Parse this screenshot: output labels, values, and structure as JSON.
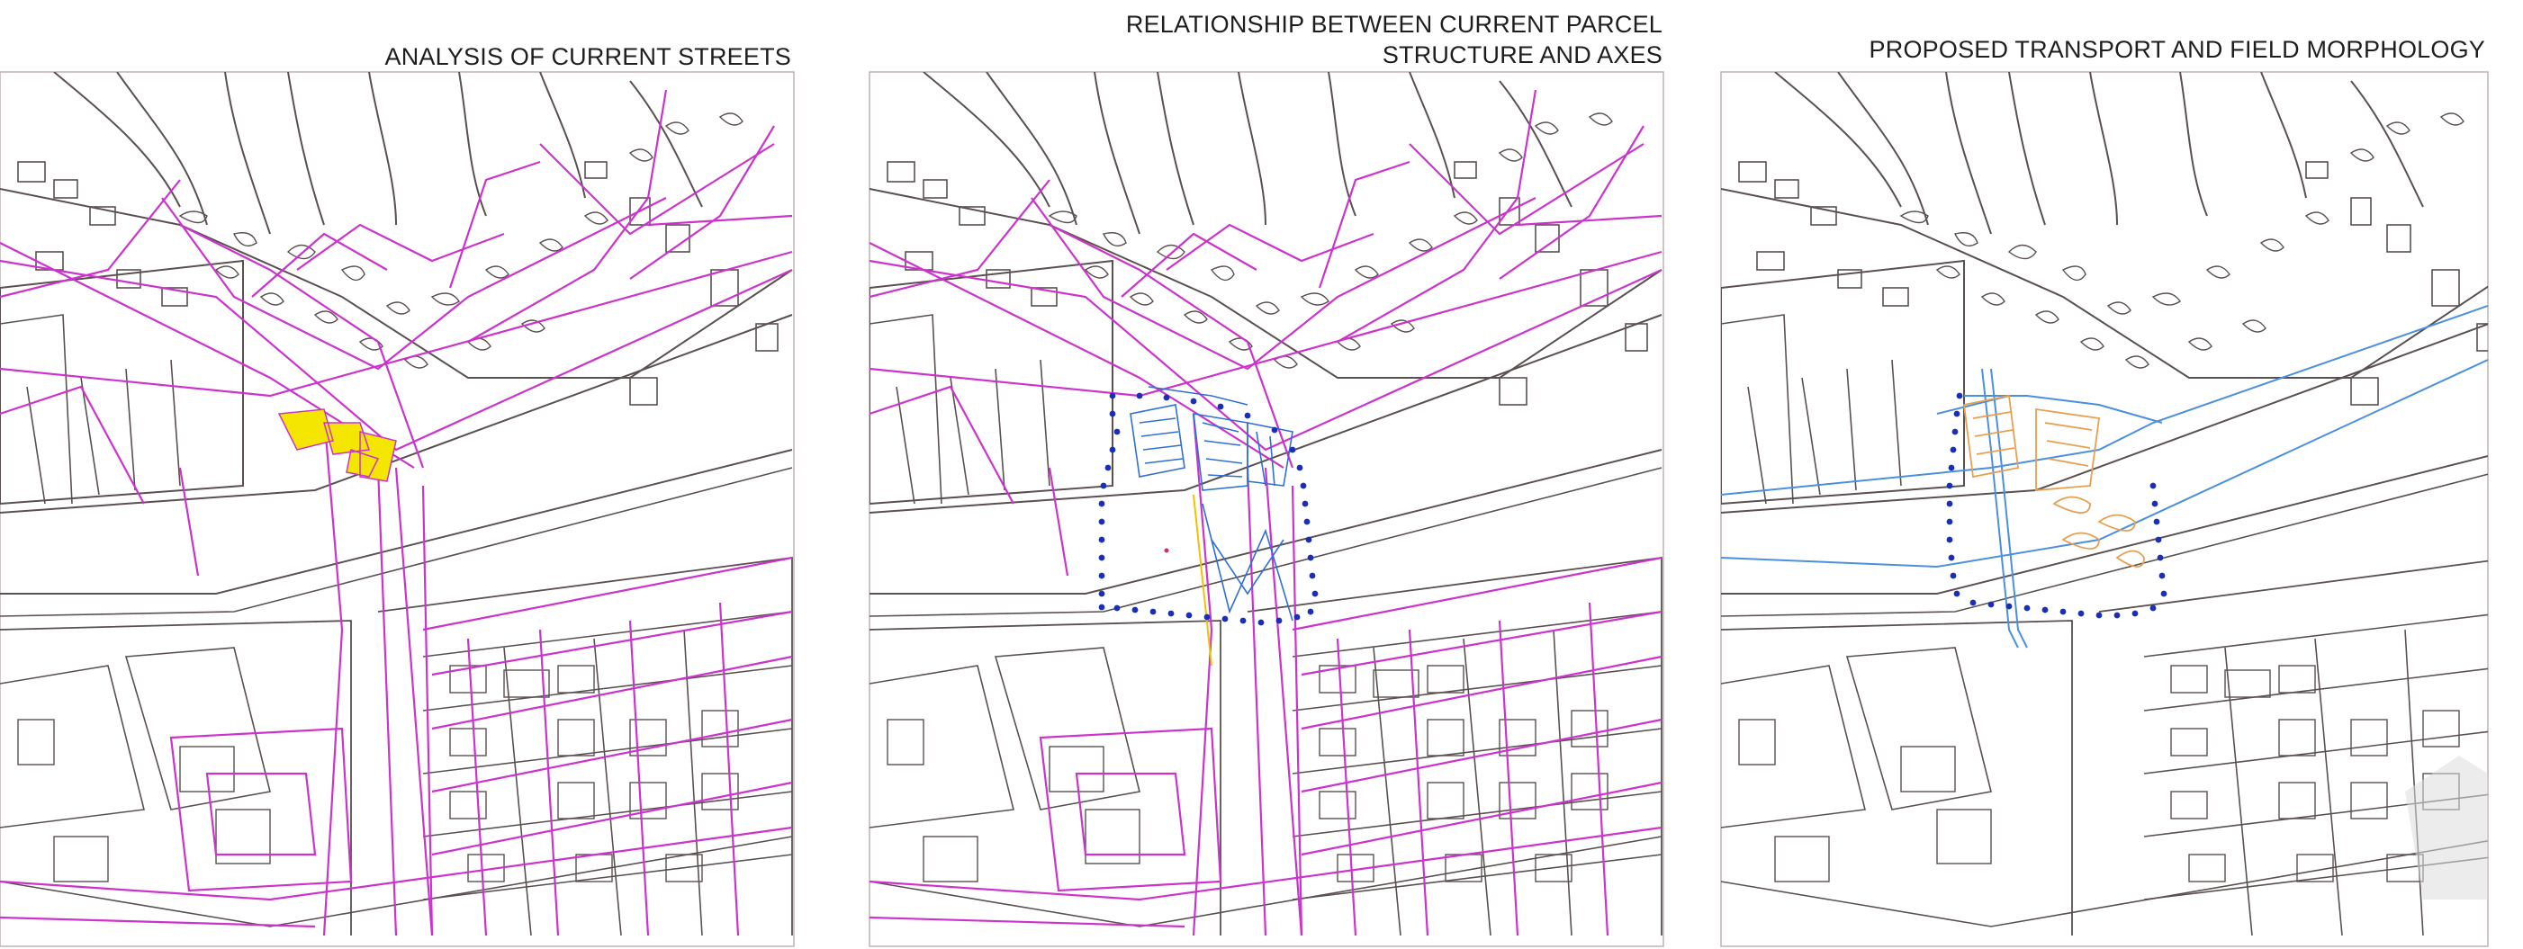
{
  "panels": [
    {
      "id": "current-streets",
      "title": [
        "ANALYSIS OF CURRENT STREETS"
      ]
    },
    {
      "id": "parcel-structure",
      "title": [
        "RELATIONSHIP BETWEEN CURRENT PARCEL",
        "STRUCTURE AND AXES"
      ]
    },
    {
      "id": "proposed-transport",
      "title": [
        "PROPOSED TRANSPORT AND FIELD MORPHOLOGY"
      ]
    }
  ],
  "colors": {
    "base_lines": "#5a5050",
    "street_analysis": "#cc33cc",
    "highlight_block": "#f5e600",
    "parcel_blue": "#2f6fd6",
    "boundary_dots": "#1a2fb8",
    "proposed_axis": "#4a8fe0",
    "proposed_parcels": "#e8a050"
  }
}
